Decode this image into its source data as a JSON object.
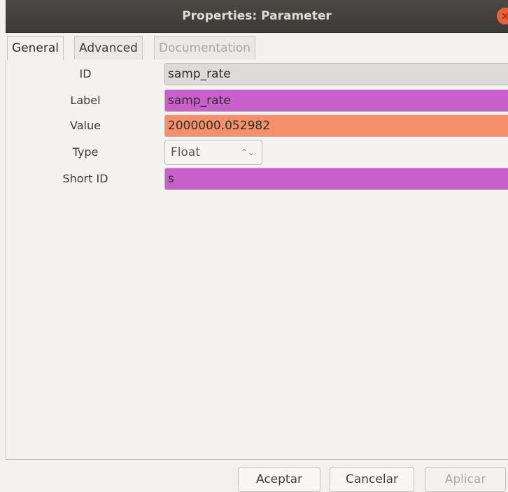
{
  "window": {
    "title": "Properties: Parameter",
    "close_glyph": "×"
  },
  "tabs": [
    {
      "label": "General",
      "active": true
    },
    {
      "label": "Advanced",
      "active": false
    },
    {
      "label": "Documentation",
      "active": false,
      "disabled": true
    }
  ],
  "fields": {
    "id": {
      "label": "ID",
      "value": "samp_rate"
    },
    "label": {
      "label": "Label",
      "value": "samp_rate"
    },
    "value": {
      "label": "Value",
      "value": "2000000.052982"
    },
    "type": {
      "label": "Type",
      "value": "Float",
      "spinner_glyph": "⌃⌄"
    },
    "short_id": {
      "label": "Short ID",
      "value": "s"
    }
  },
  "buttons": {
    "ok": "Aceptar",
    "cancel": "Cancelar",
    "apply": "Aplicar"
  },
  "colors": {
    "label_field": "#c95fcb",
    "value_field": "#f7906a",
    "titlebar": "#3c3b37"
  }
}
